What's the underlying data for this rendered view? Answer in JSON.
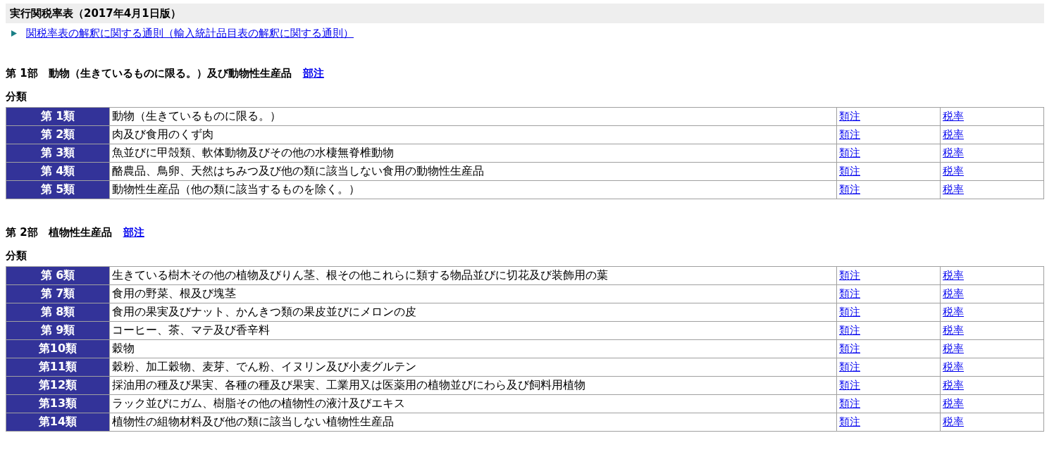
{
  "title": "実行関税率表（2017年4月1日版）",
  "general_rules_link": "関税率表の解釈に関する通則（輸入統計品目表の解釈に関する通則）",
  "sections": [
    {
      "heading": "第 1部　動物（生きているものに限る。）及び動物性生産品",
      "notes_link": "部注",
      "subheading": "分類",
      "rows": [
        {
          "chapter": "第 1類",
          "description": "動物（生きているものに限る。）",
          "notes_link": "類注",
          "rates_link": "税率"
        },
        {
          "chapter": "第 2類",
          "description": "肉及び食用のくず肉",
          "notes_link": "類注",
          "rates_link": "税率"
        },
        {
          "chapter": "第 3類",
          "description": "魚並びに甲殻類、軟体動物及びその他の水棲無脊椎動物",
          "notes_link": "類注",
          "rates_link": "税率"
        },
        {
          "chapter": "第 4類",
          "description": "酪農品、鳥卵、天然はちみつ及び他の類に該当しない食用の動物性生産品",
          "notes_link": "類注",
          "rates_link": "税率"
        },
        {
          "chapter": "第 5類",
          "description": "動物性生産品（他の類に該当するものを除く。）",
          "notes_link": "類注",
          "rates_link": "税率"
        }
      ]
    },
    {
      "heading": "第 2部　植物性生産品",
      "notes_link": "部注",
      "subheading": "分類",
      "rows": [
        {
          "chapter": "第 6類",
          "description": "生きている樹木その他の植物及びりん茎、根その他これらに類する物品並びに切花及び装飾用の葉",
          "notes_link": "類注",
          "rates_link": "税率"
        },
        {
          "chapter": "第 7類",
          "description": "食用の野菜、根及び塊茎",
          "notes_link": "類注",
          "rates_link": "税率"
        },
        {
          "chapter": "第 8類",
          "description": "食用の果実及びナット、かんきつ類の果皮並びにメロンの皮",
          "notes_link": "類注",
          "rates_link": "税率"
        },
        {
          "chapter": "第 9類",
          "description": "コーヒー、茶、マテ及び香辛料",
          "notes_link": "類注",
          "rates_link": "税率"
        },
        {
          "chapter": "第10類",
          "description": "穀物",
          "notes_link": "類注",
          "rates_link": "税率"
        },
        {
          "chapter": "第11類",
          "description": "穀粉、加工穀物、麦芽、でん粉、イヌリン及び小麦グルテン",
          "notes_link": "類注",
          "rates_link": "税率"
        },
        {
          "chapter": "第12類",
          "description": "採油用の種及び果実、各種の種及び果実、工業用又は医薬用の植物並びにわら及び飼料用植物",
          "notes_link": "類注",
          "rates_link": "税率"
        },
        {
          "chapter": "第13類",
          "description": "ラック並びにガム、樹脂その他の植物性の液汁及びエキス",
          "notes_link": "類注",
          "rates_link": "税率"
        },
        {
          "chapter": "第14類",
          "description": "植物性の組物材料及び他の類に該当しない植物性生産品",
          "notes_link": "類注",
          "rates_link": "税率"
        }
      ]
    }
  ]
}
